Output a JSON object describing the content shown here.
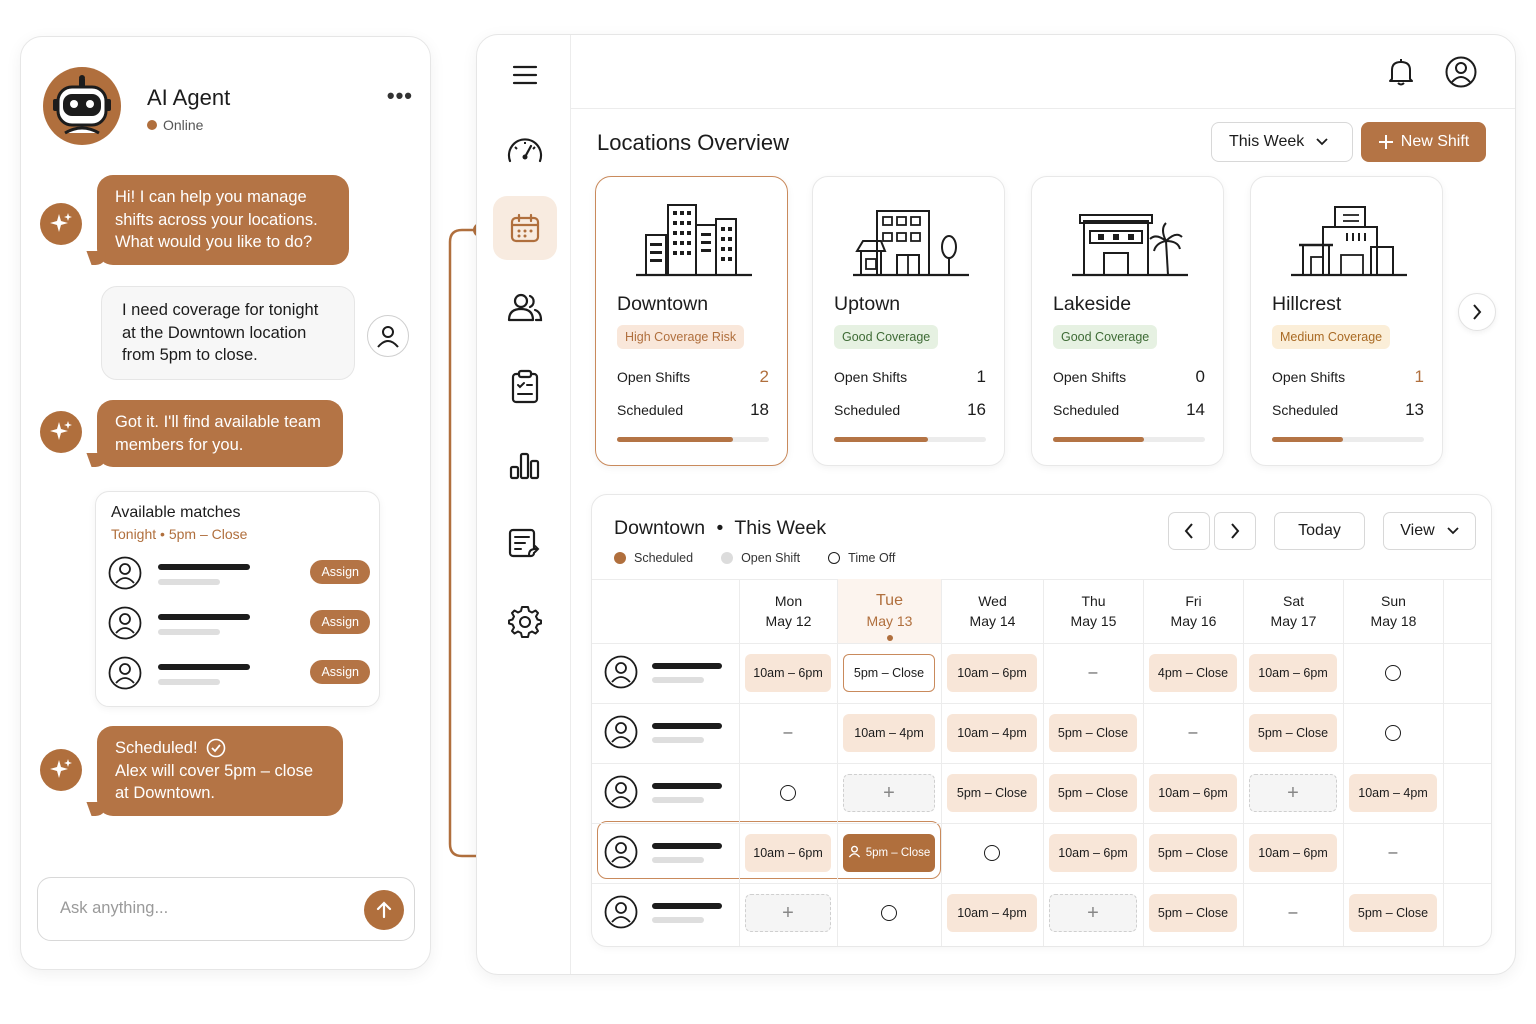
{
  "chat": {
    "agent_name": "AI Agent",
    "agent_status": "Online",
    "more_label": "•••",
    "messages": [
      {
        "from": "ai",
        "text": "Hi! I can help you manage shifts across your locations. What would you like to do?"
      },
      {
        "from": "user",
        "text": "I need coverage for tonight at the Downtown location from 5pm to close."
      },
      {
        "from": "ai",
        "text": "Got it. I'll find available team members for you."
      },
      {
        "from": "ai",
        "title": "Scheduled!",
        "text": "Alex will cover 5pm – close at Downtown."
      }
    ],
    "matches": {
      "title": "Available matches",
      "subtitle": "Tonight • 5pm – Close",
      "assign_label": "Assign"
    },
    "input_placeholder": "Ask anything..."
  },
  "header": {
    "title": "Locations Overview",
    "week_select": "This Week",
    "new_shift": "New Shift"
  },
  "locations": [
    {
      "name": "Downtown",
      "badge": "High Coverage Risk",
      "badge_type": "risk",
      "open_label": "Open Shifts",
      "open": "2",
      "scheduled_label": "Scheduled",
      "scheduled": "18",
      "coverage": 0.76
    },
    {
      "name": "Uptown",
      "badge": "Good Coverage",
      "badge_type": "good",
      "open_label": "Open Shifts",
      "open": "1",
      "scheduled_label": "Scheduled",
      "scheduled": "16",
      "coverage": 0.62
    },
    {
      "name": "Lakeside",
      "badge": "Good Coverage",
      "badge_type": "good",
      "open_label": "Open Shifts",
      "open": "0",
      "scheduled_label": "Scheduled",
      "scheduled": "14",
      "coverage": 0.6
    },
    {
      "name": "Hillcrest",
      "badge": "Medium Coverage",
      "badge_type": "med",
      "open_label": "Open Shifts",
      "open": "1",
      "scheduled_label": "Scheduled",
      "scheduled": "13",
      "coverage": 0.47
    }
  ],
  "schedule": {
    "title": "Downtown",
    "title_sep": "•",
    "period": "This Week",
    "legend": {
      "scheduled": "Scheduled",
      "open": "Open Shift",
      "time_off": "Time Off"
    },
    "today_btn": "Today",
    "view_btn": "View",
    "days": [
      {
        "day": "Mon",
        "date": "May 12"
      },
      {
        "day": "Tue",
        "date": "May 13",
        "today": true
      },
      {
        "day": "Wed",
        "date": "May 14"
      },
      {
        "day": "Thu",
        "date": "May 15"
      },
      {
        "day": "Fri",
        "date": "May 16"
      },
      {
        "day": "Sat",
        "date": "May 17"
      },
      {
        "day": "Sun",
        "date": "May 18"
      }
    ],
    "rows": [
      [
        "10am – 6pm",
        "5pm – Close",
        "10am – 6pm",
        "–",
        "4pm – Close",
        "10am – 6pm",
        "○"
      ],
      [
        "–",
        "10am – 4pm",
        "10am – 4pm",
        "5pm – Close",
        "–",
        "5pm – Close",
        "○"
      ],
      [
        "○",
        "+",
        "5pm – Close",
        "5pm – Close",
        "10am – 6pm",
        "+",
        "10am – 4pm"
      ],
      [
        "10am – 6pm",
        "5pm – Close",
        "○",
        "10am – 6pm",
        "5pm – Close",
        "10am – 6pm",
        "–"
      ],
      [
        "+",
        "○",
        "10am – 4pm",
        "+",
        "5pm – Close",
        "–",
        "5pm – Close"
      ]
    ]
  },
  "colors": {
    "accent": "#b06f3d",
    "accent_light": "#f8e6d8",
    "good": "#e6f1e2"
  }
}
